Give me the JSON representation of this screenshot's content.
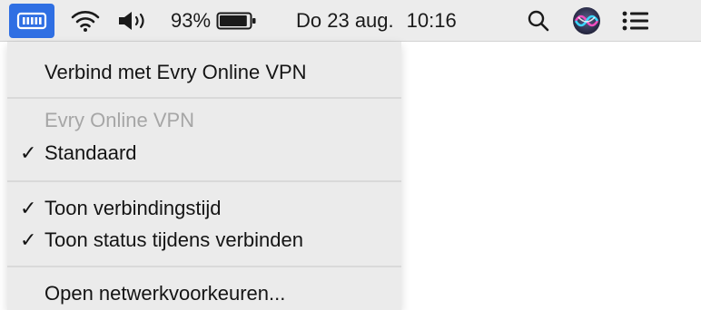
{
  "menubar": {
    "battery_percent": "93%",
    "date": "Do 23 aug.",
    "time": "10:16",
    "battery_level": 0.93
  },
  "menu": {
    "connect_label": "Verbind met Evry Online VPN",
    "config_header": "Evry Online VPN",
    "config_standard": "Standaard",
    "show_connect_time": "Toon verbindingstijd",
    "show_status": "Toon status tijdens verbinden",
    "open_prefs": "Open netwerkvoorkeuren...",
    "check_glyph": "✓"
  },
  "colors": {
    "vpn_tile": "#2f6fe3",
    "menubar_bg": "#ececec",
    "menu_bg": "#ebebeb",
    "disabled_text": "#a6a6a6"
  }
}
